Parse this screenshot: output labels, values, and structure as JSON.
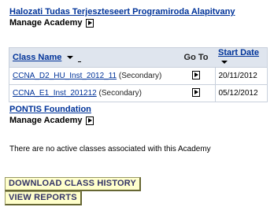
{
  "academy1": {
    "name": "Halozati Tudas Terjeszteseert Programiroda Alapitvany",
    "manage_label": "Manage Academy"
  },
  "table": {
    "headers": {
      "class_name": "Class Name",
      "go_to": "Go To",
      "start_date": "Start Date"
    },
    "rows": [
      {
        "class_name": "CCNA_D2_HU_Inst_2012_11",
        "type": "(Secondary)",
        "start_date": "20/11/2012"
      },
      {
        "class_name": "CCNA_E1_Inst_201212",
        "type": "(Secondary)",
        "start_date": "05/12/2012"
      }
    ]
  },
  "academy2": {
    "name": "PONTIS Foundation",
    "manage_label": "Manage Academy",
    "empty_message": "There are no active classes associated with this Academy"
  },
  "buttons": {
    "download_history": "DOWNLOAD CLASS HISTORY",
    "view_reports": "VIEW REPORTS"
  },
  "colors": {
    "link": "#003399",
    "header_bg": "#dfe5ee",
    "button_bg": "#ffffcc"
  },
  "icons": {
    "go": "play-arrow-icon",
    "sort": "sort-down-icon"
  }
}
